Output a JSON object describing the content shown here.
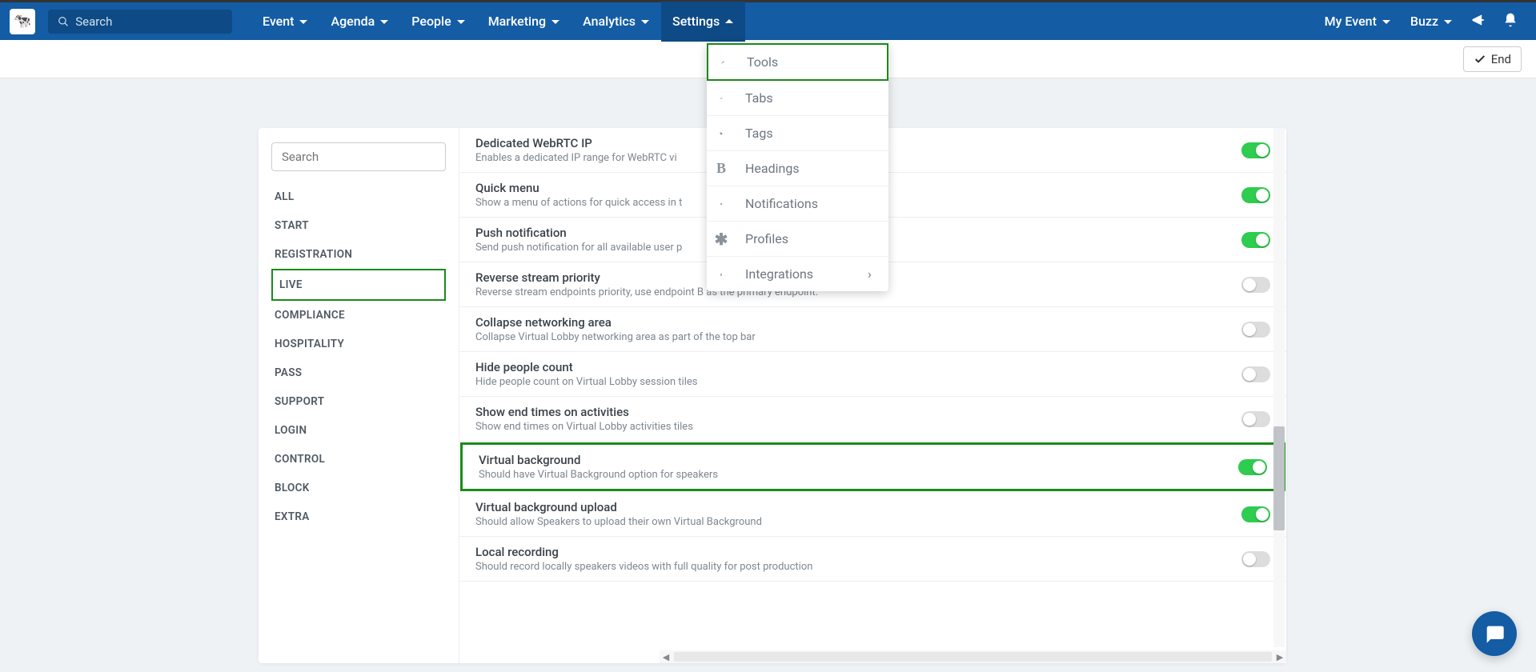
{
  "topnav": {
    "search_placeholder": "Search",
    "items": [
      "Event",
      "Agenda",
      "People",
      "Marketing",
      "Analytics",
      "Settings"
    ],
    "active_index": 5,
    "right_items": [
      "My Event",
      "Buzz"
    ]
  },
  "subheader": {
    "end_label": "End"
  },
  "dropdown": {
    "items": [
      {
        "label": "Tools",
        "icon": "wrench",
        "highlighted": true
      },
      {
        "label": "Tabs",
        "icon": "list"
      },
      {
        "label": "Tags",
        "icon": "tag"
      },
      {
        "label": "Headings",
        "icon": "bold"
      },
      {
        "label": "Notifications",
        "icon": "megaphone"
      },
      {
        "label": "Profiles",
        "icon": "asterisk"
      },
      {
        "label": "Integrations",
        "icon": "flask",
        "has_submenu": true
      }
    ]
  },
  "sidebar": {
    "search_placeholder": "Search",
    "items": [
      "ALL",
      "START",
      "REGISTRATION",
      "LIVE",
      "COMPLIANCE",
      "HOSPITALITY",
      "PASS",
      "SUPPORT",
      "LOGIN",
      "CONTROL",
      "BLOCK",
      "EXTRA"
    ],
    "selected_index": 3
  },
  "settings": [
    {
      "title": "Dedicated WebRTC IP",
      "desc": "Enables a dedicated IP range for WebRTC vi",
      "on": true
    },
    {
      "title": "Quick menu",
      "desc": "Show a menu of actions for quick access in t",
      "on": true
    },
    {
      "title": "Push notification",
      "desc": "Send push notification for all available user p",
      "on": true
    },
    {
      "title": "Reverse stream priority",
      "desc": "Reverse stream endpoints priority, use endpoint B as the primary endpoint.",
      "on": false
    },
    {
      "title": "Collapse networking area",
      "desc": "Collapse Virtual Lobby networking area as part of the top bar",
      "on": false
    },
    {
      "title": "Hide people count",
      "desc": "Hide people count on Virtual Lobby session tiles",
      "on": false
    },
    {
      "title": "Show end times on activities",
      "desc": "Show end times on Virtual Lobby activities tiles",
      "on": false
    },
    {
      "title": "Virtual background",
      "desc": "Should have Virtual Background option for speakers",
      "on": true,
      "highlighted": true
    },
    {
      "title": "Virtual background upload",
      "desc": "Should allow Speakers to upload their own Virtual Background",
      "on": true
    },
    {
      "title": "Local recording",
      "desc": "Should record locally speakers videos with full quality for post production",
      "on": false
    }
  ]
}
